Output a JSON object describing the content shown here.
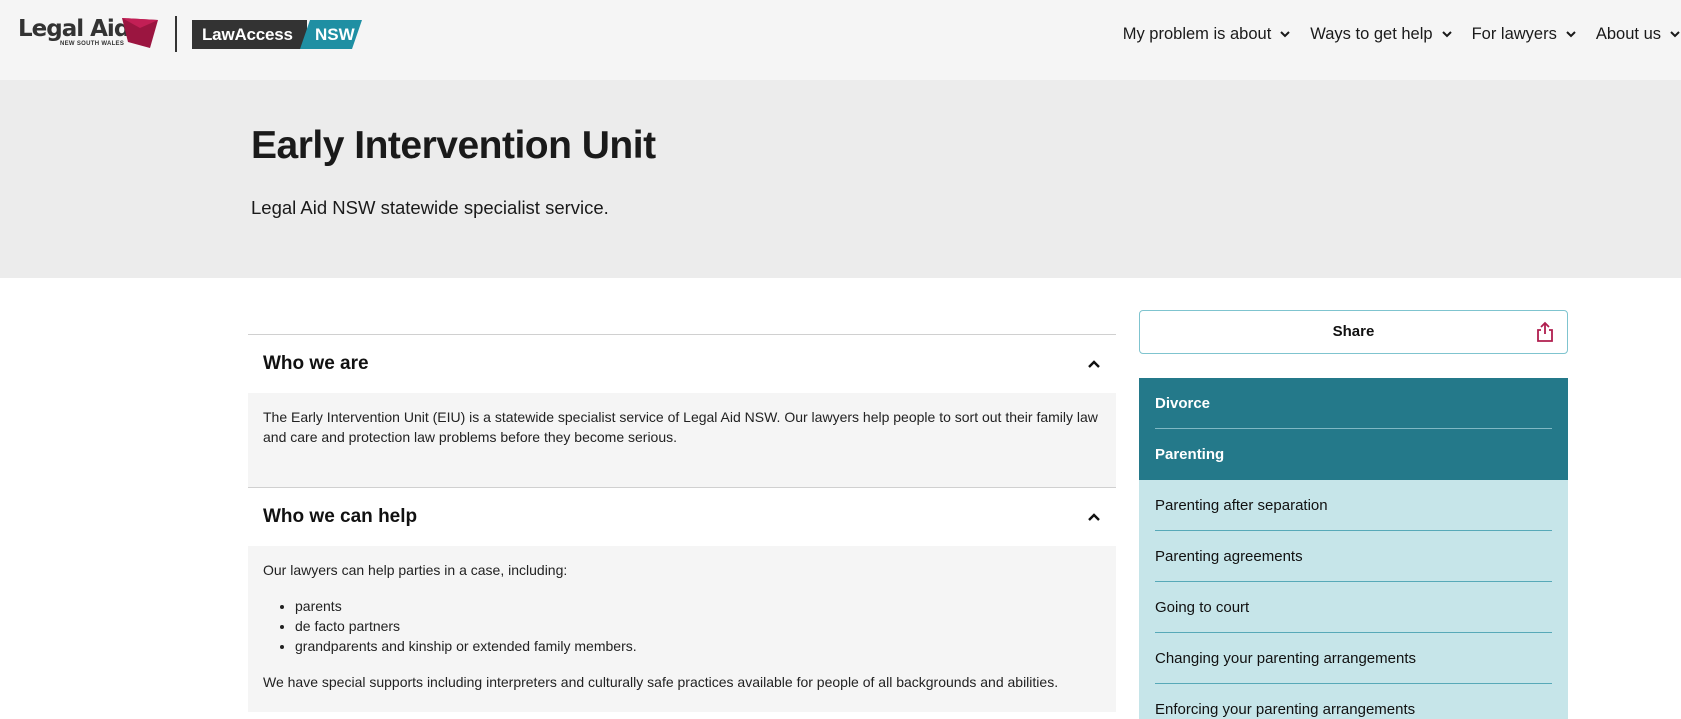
{
  "header": {
    "logo_legalaid": "Legal Aid",
    "logo_legalaid_sub": "NEW SOUTH WALES",
    "logo_lawaccess": "LawAccess",
    "logo_nsw": "NSW",
    "nav": [
      {
        "label": "My problem is about"
      },
      {
        "label": "Ways to get help"
      },
      {
        "label": "For lawyers"
      },
      {
        "label": "About us"
      }
    ]
  },
  "hero": {
    "title": "Early Intervention Unit",
    "subtitle": "Legal Aid NSW statewide specialist service."
  },
  "accordions": [
    {
      "title": "Who we are",
      "body": "The Early Intervention Unit (EIU) is a statewide specialist service of Legal Aid NSW. Our lawyers help people to sort out their family law and care and protection law problems before they become serious."
    },
    {
      "title": "Who we can help",
      "intro": "Our lawyers can help parties in a case, including:",
      "list": [
        "parents",
        "de facto partners",
        "grandparents and kinship or extended family members."
      ],
      "outro": "We have special supports including interpreters and culturally safe practices available for people of all backgrounds and abilities."
    }
  ],
  "sidebar": {
    "share_label": "Share",
    "nav": [
      {
        "label": "Divorce"
      },
      {
        "label": "Parenting"
      },
      {
        "label": "Parenting after separation"
      },
      {
        "label": "Parenting agreements"
      },
      {
        "label": "Going to court"
      },
      {
        "label": "Changing your parenting arrangements"
      },
      {
        "label": "Enforcing your parenting arrangements"
      }
    ]
  },
  "colors": {
    "teal_dark": "#24798a",
    "teal_light": "#c6e5e9",
    "nsw_teal": "#1f8fa3",
    "legal_aid_red": "#9b1540"
  }
}
